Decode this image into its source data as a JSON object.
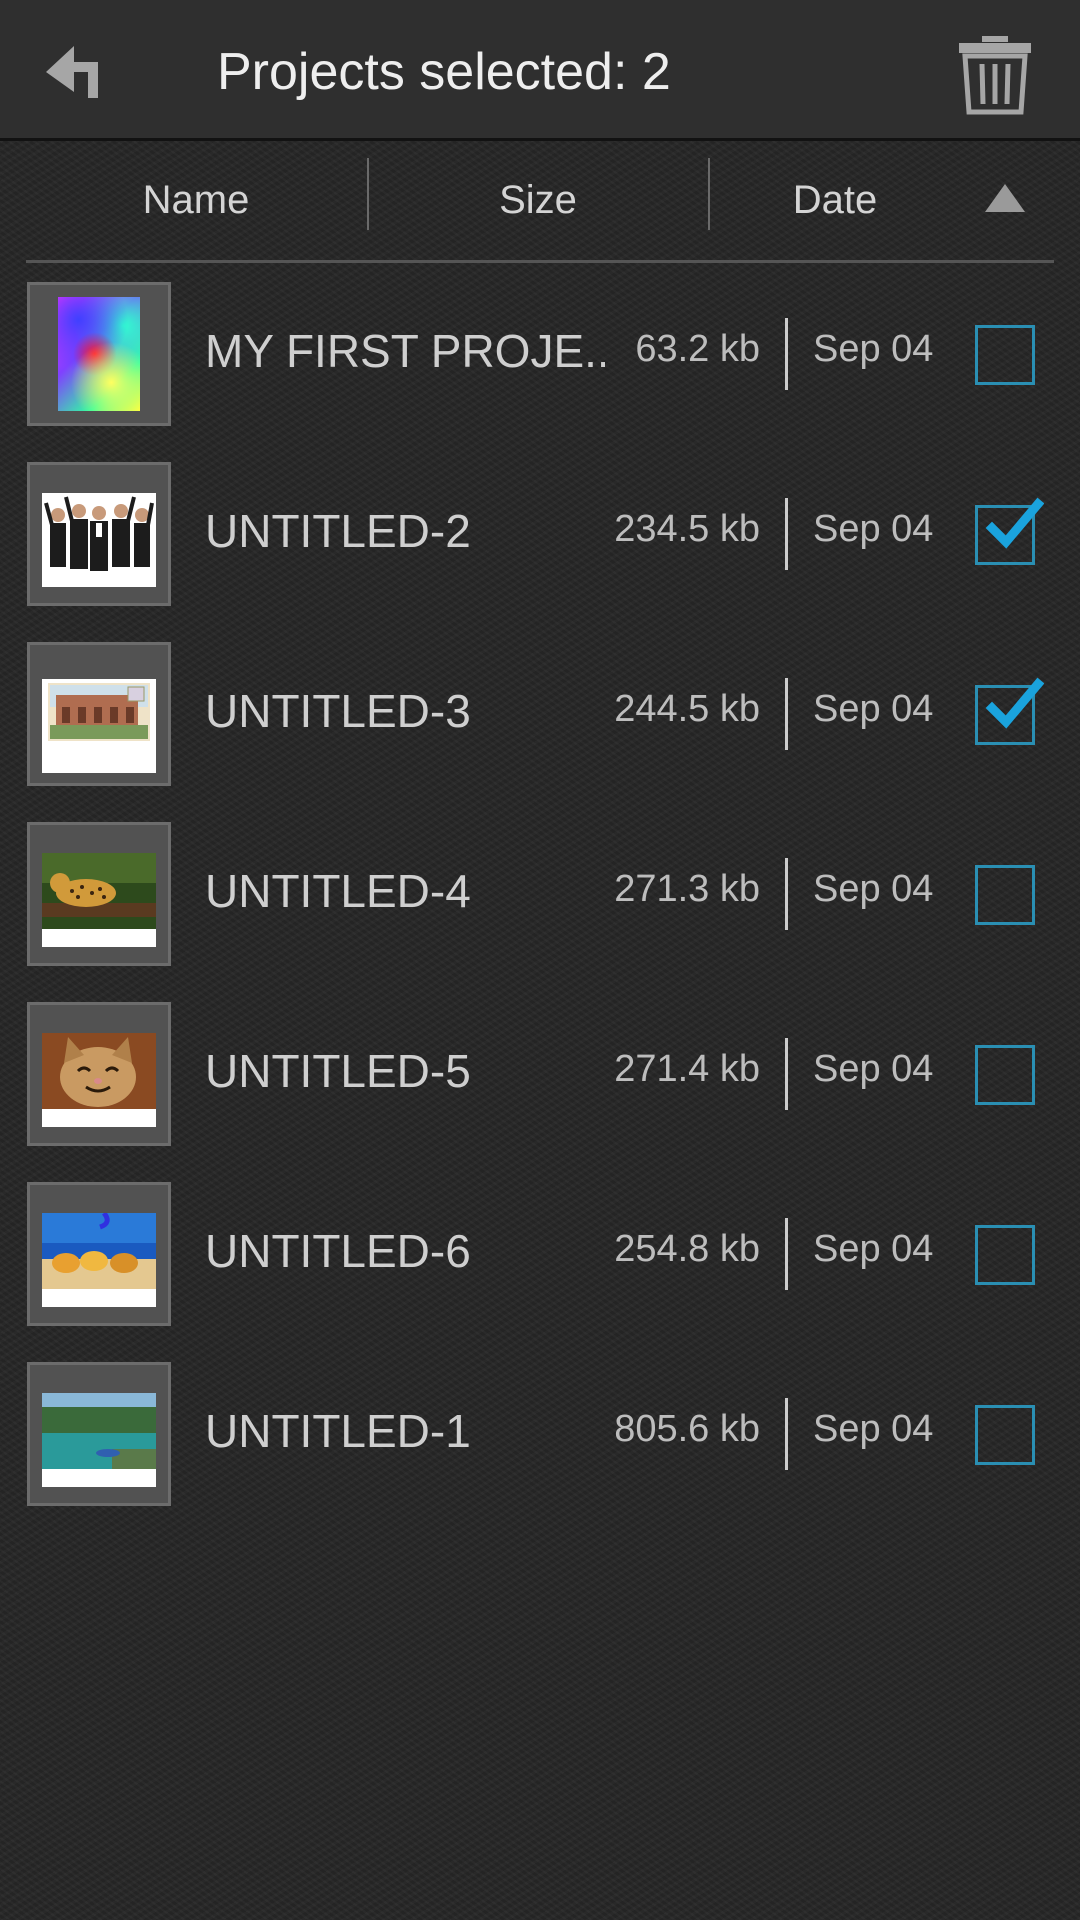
{
  "header": {
    "title": "Projects selected: 2",
    "back_icon": "back-arrow-icon",
    "delete_icon": "trash-icon"
  },
  "sort_bar": {
    "name_label": "Name",
    "size_label": "Size",
    "date_label": "Date",
    "sort_icon": "triangle-up-icon"
  },
  "projects": [
    {
      "name": "MY FIRST PROJE...",
      "size": "63.2 kb",
      "date": "Sep 04",
      "checked": false,
      "thumbnail": "colorful-gradient"
    },
    {
      "name": "UNTITLED-2",
      "size": "234.5 kb",
      "date": "Sep 04",
      "checked": true,
      "thumbnail": "business-people-cheering"
    },
    {
      "name": "UNTITLED-3",
      "size": "244.5 kb",
      "date": "Sep 04",
      "checked": true,
      "thumbnail": "mission-building-postcard"
    },
    {
      "name": "UNTITLED-4",
      "size": "271.3 kb",
      "date": "Sep 04",
      "checked": false,
      "thumbnail": "jaguar-on-log"
    },
    {
      "name": "UNTITLED-5",
      "size": "271.4 kb",
      "date": "Sep 04",
      "checked": false,
      "thumbnail": "smiling-kitten"
    },
    {
      "name": "UNTITLED-6",
      "size": "254.8 kb",
      "date": "Sep 04",
      "checked": false,
      "thumbnail": "beach-sandals"
    },
    {
      "name": "UNTITLED-1",
      "size": "805.6 kb",
      "date": "Sep 04",
      "checked": false,
      "thumbnail": "lake-boat-landscape"
    }
  ],
  "colors": {
    "checkbox_border": "#2a8fb3",
    "check_mark": "#1aa3dd",
    "background": "#262626",
    "topbar": "#2f2f2f"
  }
}
